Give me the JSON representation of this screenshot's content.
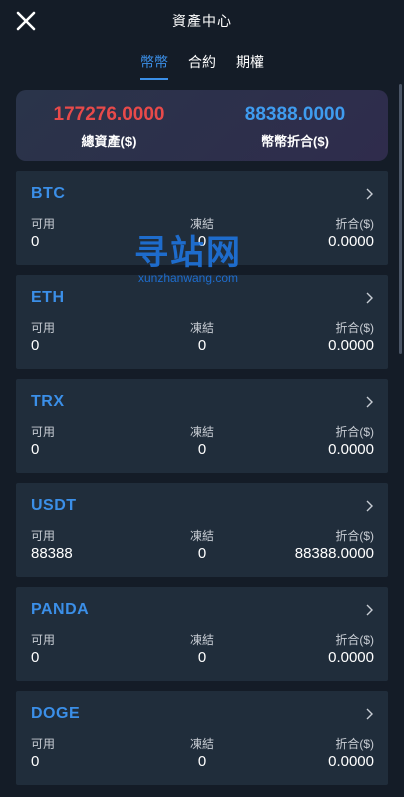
{
  "header": {
    "title": "資產中心",
    "close_icon": "close-icon"
  },
  "tabs": [
    {
      "label": "幣幣",
      "active": true
    },
    {
      "label": "合約",
      "active": false
    },
    {
      "label": "期權",
      "active": false
    }
  ],
  "summary": {
    "total_value": "177276.0000",
    "total_label": "總資產($)",
    "fiat_value": "88388.0000",
    "fiat_label": "幣幣折合($)"
  },
  "columns": {
    "available": "可用",
    "frozen": "凍結",
    "converted": "折合($)"
  },
  "coins": [
    {
      "name": "BTC",
      "available": "0",
      "frozen": "0",
      "converted": "0.0000"
    },
    {
      "name": "ETH",
      "available": "0",
      "frozen": "0",
      "converted": "0.0000"
    },
    {
      "name": "TRX",
      "available": "0",
      "frozen": "0",
      "converted": "0.0000"
    },
    {
      "name": "USDT",
      "available": "88388",
      "frozen": "0",
      "converted": "88388.0000"
    },
    {
      "name": "PANDA",
      "available": "0",
      "frozen": "0",
      "converted": "0.0000"
    },
    {
      "name": "DOGE",
      "available": "0",
      "frozen": "0",
      "converted": "0.0000"
    }
  ],
  "watermark": {
    "title": "寻站网",
    "subtitle": "xunzhanwang.com"
  },
  "colors": {
    "accent": "#3b8fe8",
    "total": "#e84a4a",
    "background": "#141c27",
    "card": "#202d3b"
  }
}
